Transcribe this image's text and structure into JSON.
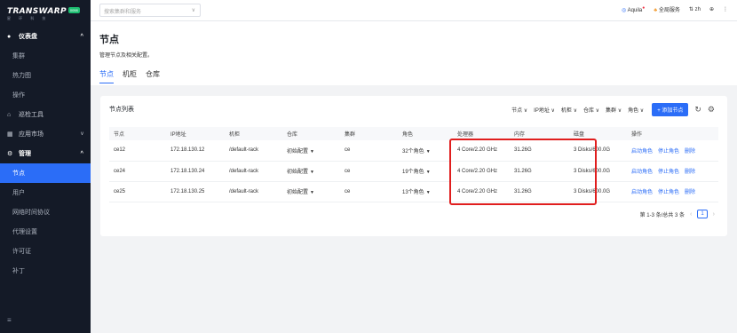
{
  "brand": {
    "name": "TRANSWARP",
    "badge": "0098",
    "sub": "星 环 科 技"
  },
  "sidebar": {
    "items": [
      {
        "label": "仪表盘",
        "icon": "●",
        "type": "group",
        "chevron": "^"
      },
      {
        "label": "集群",
        "type": "sub"
      },
      {
        "label": "热力图",
        "type": "sub"
      },
      {
        "label": "操作",
        "type": "sub"
      },
      {
        "label": "巡检工具",
        "icon": "⌂",
        "type": "item"
      },
      {
        "label": "应用市场",
        "icon": "▦",
        "type": "item",
        "chevron": "v"
      },
      {
        "label": "管理",
        "icon": "⚙",
        "type": "group",
        "chevron": "^"
      },
      {
        "label": "节点",
        "type": "sub",
        "active": true
      },
      {
        "label": "用户",
        "type": "sub"
      },
      {
        "label": "网络时间协议",
        "type": "sub"
      },
      {
        "label": "代理设置",
        "type": "sub"
      },
      {
        "label": "许可证",
        "type": "sub"
      },
      {
        "label": "补丁",
        "type": "sub"
      }
    ],
    "bottom_icon": "≡"
  },
  "topbar": {
    "search_placeholder": "搜索集群和服务",
    "user": "Aquila",
    "services": "全局服务",
    "lang": "zh",
    "globe": "⊕",
    "more": "⋮"
  },
  "page": {
    "title": "节点",
    "description": "管理节点及相关配置。",
    "tabs": [
      "节点",
      "机柜",
      "仓库"
    ]
  },
  "card": {
    "title": "节点列表",
    "filters": [
      "节点",
      "IP地址",
      "机柜",
      "仓库",
      "集群",
      "角色"
    ],
    "add_button": "+ 添加节点"
  },
  "table": {
    "columns": [
      "节点",
      "IP地址",
      "机柜",
      "仓库",
      "集群",
      "角色",
      "处理器",
      "内存",
      "磁盘",
      "操作"
    ],
    "rows": [
      {
        "node": "ce12",
        "ip": "172.18.130.12",
        "rack": "/default-rack",
        "repo": "初始配置",
        "cluster": "ce",
        "roles": "32个角色",
        "cpu": "4 Core/2.20 GHz",
        "mem": "31.26G",
        "disk": "3 Disks/600.0G"
      },
      {
        "node": "ce24",
        "ip": "172.18.130.24",
        "rack": "/default-rack",
        "repo": "初始配置",
        "cluster": "ce",
        "roles": "19个角色",
        "cpu": "4 Core/2.20 GHz",
        "mem": "31.26G",
        "disk": "3 Disks/600.0G"
      },
      {
        "node": "ce25",
        "ip": "172.18.130.25",
        "rack": "/default-rack",
        "repo": "初始配置",
        "cluster": "ce",
        "roles": "13个角色",
        "cpu": "4 Core/2.20 GHz",
        "mem": "31.26G",
        "disk": "3 Disks/600.0G"
      }
    ],
    "actions": [
      "启动角色",
      "停止角色",
      "删除"
    ]
  },
  "pager": {
    "summary": "第 1-3 条/总共 3 条",
    "current": "1"
  }
}
